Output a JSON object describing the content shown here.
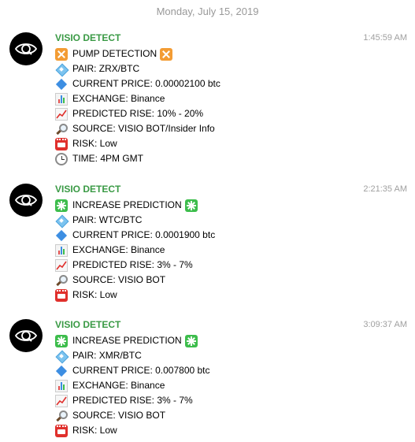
{
  "date_separator": "Monday, July 15, 2019",
  "messages": [
    {
      "sender": "VISIO DETECT",
      "time": "1:45:59 AM",
      "lines": [
        {
          "icon": "orange-x-square-icon",
          "text": "PUMP DETECTION",
          "trailing_icon": "orange-x-square-icon"
        },
        {
          "icon": "light-blue-diamond-icon",
          "text": "PAIR: ZRX/BTC"
        },
        {
          "icon": "blue-diamond-icon",
          "text": "CURRENT PRICE: 0.00002100 btc"
        },
        {
          "icon": "bar-chart-icon",
          "text": "EXCHANGE: Binance"
        },
        {
          "icon": "chart-increasing-icon",
          "text": "PREDICTED RISE: 10% - 20%"
        },
        {
          "icon": "magnifier-icon",
          "text": "SOURCE: VISIO BOT/Insider Info"
        },
        {
          "icon": "name-badge-icon",
          "text": "RISK: Low"
        },
        {
          "icon": "clock-icon",
          "text": "TIME: 4PM GMT"
        }
      ]
    },
    {
      "sender": "VISIO DETECT",
      "time": "2:21:35 AM",
      "lines": [
        {
          "icon": "green-sparkle-square-icon",
          "text": "INCREASE PREDICTION",
          "trailing_icon": "green-sparkle-square-icon"
        },
        {
          "icon": "light-blue-diamond-icon",
          "text": "PAIR: WTC/BTC"
        },
        {
          "icon": "blue-diamond-icon",
          "text": "CURRENT PRICE: 0.0001900 btc"
        },
        {
          "icon": "bar-chart-icon",
          "text": "EXCHANGE: Binance"
        },
        {
          "icon": "chart-increasing-icon",
          "text": "PREDICTED RISE: 3% - 7%"
        },
        {
          "icon": "magnifier-icon",
          "text": "SOURCE: VISIO BOT"
        },
        {
          "icon": "name-badge-icon",
          "text": "RISK: Low"
        }
      ]
    },
    {
      "sender": "VISIO DETECT",
      "time": "3:09:37 AM",
      "lines": [
        {
          "icon": "green-sparkle-square-icon",
          "text": "INCREASE PREDICTION",
          "trailing_icon": "green-sparkle-square-icon"
        },
        {
          "icon": "light-blue-diamond-icon",
          "text": "PAIR: XMR/BTC"
        },
        {
          "icon": "blue-diamond-icon",
          "text": "CURRENT PRICE: 0.007800 btc"
        },
        {
          "icon": "bar-chart-icon",
          "text": "EXCHANGE: Binance"
        },
        {
          "icon": "chart-increasing-icon",
          "text": "PREDICTED RISE: 3% - 7%"
        },
        {
          "icon": "magnifier-icon",
          "text": "SOURCE: VISIO BOT"
        },
        {
          "icon": "name-badge-icon",
          "text": "RISK: Low"
        }
      ]
    }
  ],
  "colors": {
    "sender": "#3a9a45",
    "timestamp": "#a0a0a0",
    "date_separator": "#999999",
    "avatar_bg": "#000000"
  }
}
